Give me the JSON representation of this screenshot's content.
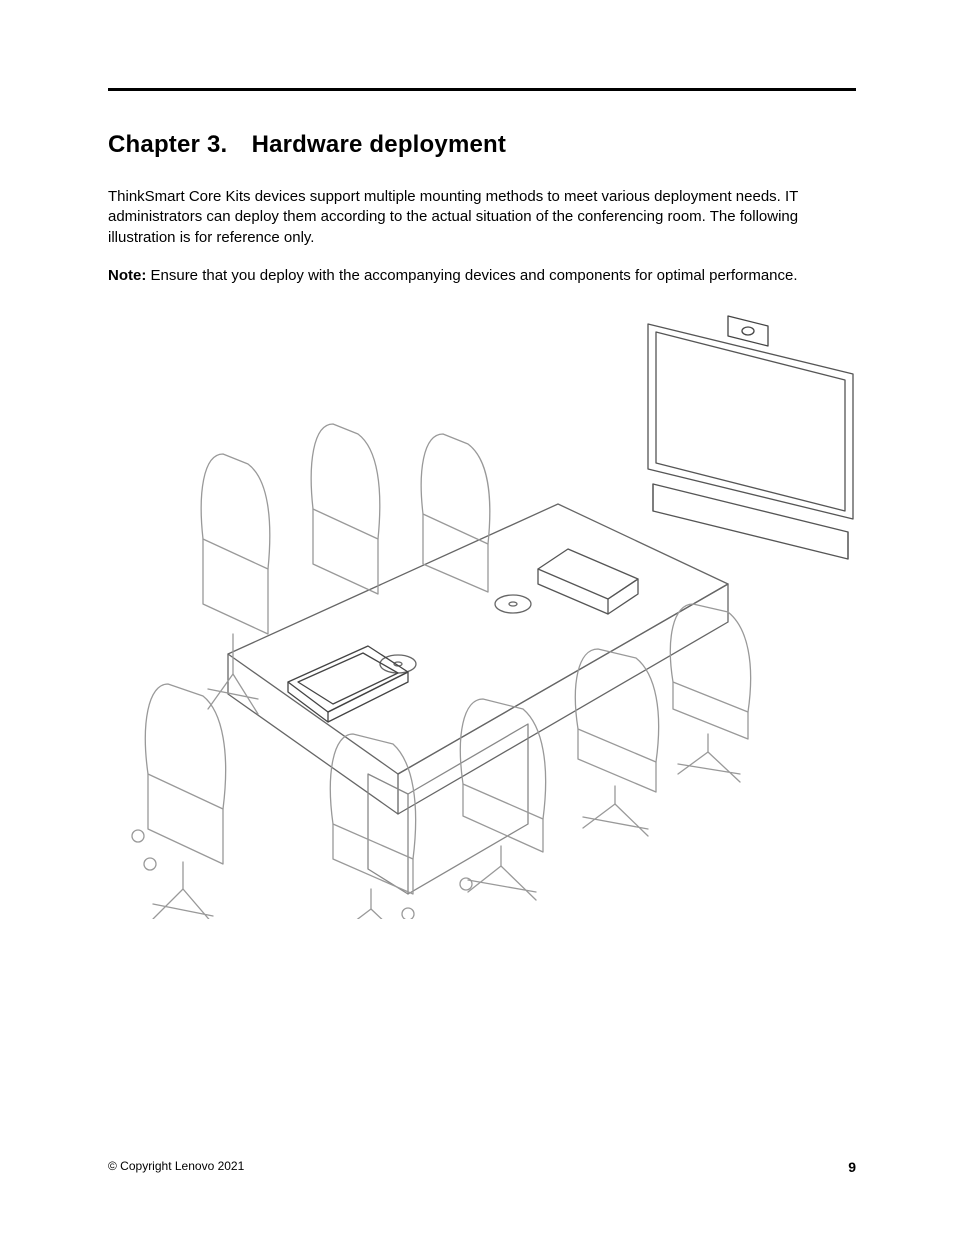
{
  "heading": "Chapter 3. Hardware deployment",
  "paragraph": "ThinkSmart Core Kits devices support multiple mounting methods to meet various deployment needs. IT administrators can deploy them according to the actual situation of the conferencing room. The following illustration is for reference only.",
  "note_label": "Note:",
  "note_text": "Ensure that you deploy with the accompanying devices and components for optimal performance.",
  "footer_left": "© Copyright Lenovo 2021",
  "footer_right": "9"
}
